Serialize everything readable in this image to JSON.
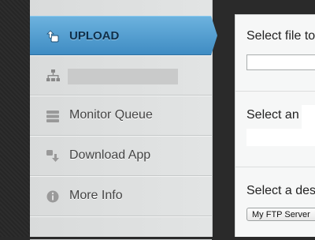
{
  "sidebar": {
    "items": [
      {
        "label": "UPLOAD",
        "icon": "upload-icon",
        "active": true
      },
      {
        "label": "",
        "icon": "network-icon",
        "active": false,
        "redacted": true
      },
      {
        "label": "Monitor Queue",
        "icon": "queue-icon",
        "active": false
      },
      {
        "label": "Download App",
        "icon": "download-app-icon",
        "active": false
      },
      {
        "label": "More Info",
        "icon": "info-icon",
        "active": false
      }
    ],
    "active_color": "#4f9dd1"
  },
  "main": {
    "section1": {
      "heading": "Select file to"
    },
    "section2": {
      "heading": "Select an"
    },
    "section3": {
      "heading": "Select a des",
      "select_value": "My FTP Server"
    }
  }
}
